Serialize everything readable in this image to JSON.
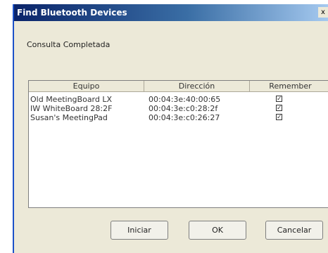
{
  "window": {
    "title": "Find Bluetooth Devices",
    "close_label": "x"
  },
  "status_text": "Consulta Completada",
  "devices": {
    "columns": [
      "Equipo",
      "Dirección",
      "Remember"
    ],
    "rows": [
      {
        "name": "Old MeetingBoard LX",
        "address": "00:04:3e:40:00:65",
        "remember": true
      },
      {
        "name": "IW WhiteBoard 28:2F",
        "address": "00:04:3e:c0:28:2f",
        "remember": true
      },
      {
        "name": "Susan's MeetingPad",
        "address": "00:04:3e:c0:26:27",
        "remember": true
      }
    ]
  },
  "buttons": {
    "start": "Iniciar",
    "ok": "OK",
    "cancel": "Cancelar"
  }
}
